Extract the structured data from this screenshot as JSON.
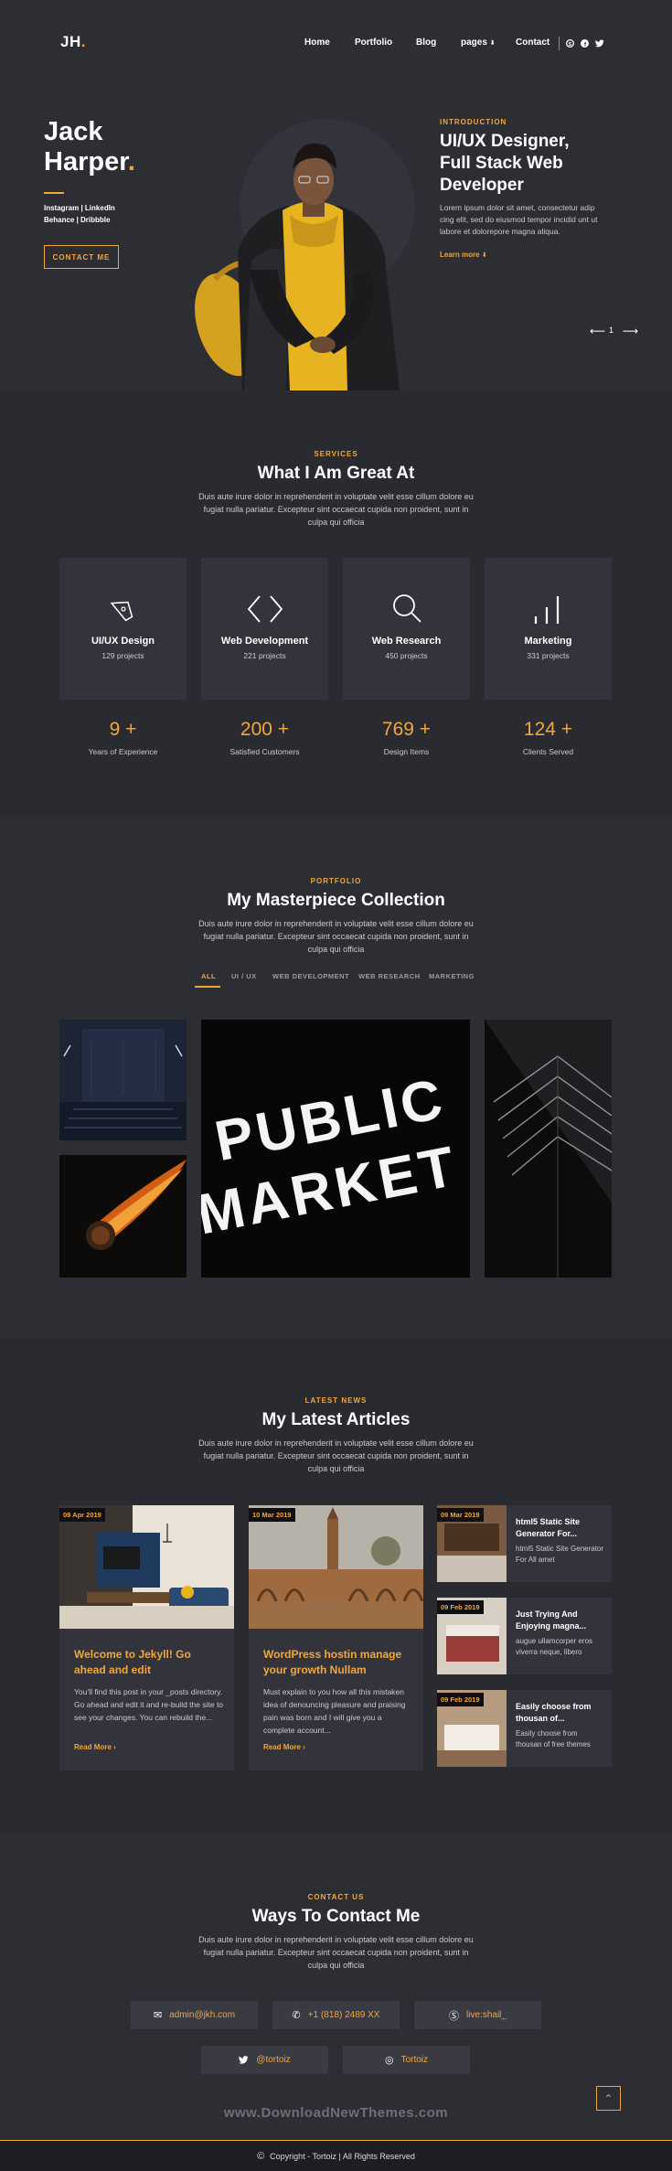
{
  "nav": {
    "logo_text": "JH",
    "logo_dot": ".",
    "items": [
      "Home",
      "Portfolio",
      "Blog",
      "pages",
      "Contact"
    ],
    "pages_caret": "⬇",
    "social_icons": [
      "skype-icon",
      "facebook-icon",
      "twitter-icon"
    ]
  },
  "hero": {
    "first_name": "Jack",
    "last_name": "Harper",
    "name_dot": ".",
    "links_line1": "Instagram | LinkedIn",
    "links_line2": "Behance | Dribbble",
    "button": "CONTACT ME",
    "intro_label": "INTRODUCTION",
    "intro_title": "UI/UX Designer, Full Stack Web Developer",
    "intro_text": "Lorem ipsum dolor sit amet, consectetur adip cing elit, sed do eiusmod tempor incidid unt ut labore et dolorepore magna aliqua.",
    "learn_more": "Learn more",
    "learn_caret": "⬇",
    "slide_number": "1"
  },
  "services": {
    "label": "SERVICES",
    "title": "What I Am Great At",
    "desc": "Duis aute irure dolor in reprehenderit in voluptate velit esse cillum dolore eu fugiat nulla pariatur. Excepteur sint occaecat cupida non proident, sunt in culpa qui officia",
    "cards": [
      {
        "title": "UI/UX Design",
        "sub": "129 projects",
        "icon": "pen-tool-icon"
      },
      {
        "title": "Web Development",
        "sub": "221 projects",
        "icon": "code-brackets-icon"
      },
      {
        "title": "Web Research",
        "sub": "450 projects",
        "icon": "magnifier-icon"
      },
      {
        "title": "Marketing",
        "sub": "331 projects",
        "icon": "bar-chart-icon"
      }
    ],
    "stats": [
      {
        "num": "9 +",
        "label": "Years of Experience"
      },
      {
        "num": "200 +",
        "label": "Satisfied Customers"
      },
      {
        "num": "769 +",
        "label": "Design Items"
      },
      {
        "num": "124 +",
        "label": "Clients Served"
      }
    ]
  },
  "portfolio": {
    "label": "PORTFOLIO",
    "title": "My Masterpiece Collection",
    "desc": "Duis aute irure dolor in reprehenderit in voluptate velit esse cillum dolore eu fugiat nulla pariatur. Excepteur sint occaecat cupida non proident, sunt in culpa qui officia",
    "filters": [
      "ALL",
      "UI / UX",
      "WEB DEVELOPMENT",
      "WEB RESEARCH",
      "MARKETING"
    ],
    "sign_line1": "PUBLIC",
    "sign_line2": "MARKET"
  },
  "news": {
    "label": "LATEST NEWS",
    "title": "My Latest Articles",
    "desc": "Duis aute irure dolor in reprehenderit in voluptate velit esse cillum dolore eu fugiat nulla pariatur. Excepteur sint occaecat cupida non proident, sunt in culpa qui officia",
    "posts": [
      {
        "date": "08 Apr 2019",
        "title": "Welcome to Jekyll! Go ahead and edit",
        "text": "You’ll find this post in your _posts directory. Go ahead and edit it and re-build the site to see your changes. You can rebuild the...",
        "read": "Read More"
      },
      {
        "date": "10 Mar 2019",
        "title": "WordPress hostin manage your growth Nullam",
        "text": "Must explain to you how all this mistaken idea of denouncing pleasure and praising pain was born and I will give you a complete account...",
        "read": "Read More"
      }
    ],
    "side_posts": [
      {
        "date": "09 Mar 2019",
        "title": "html5 Static Site Generator For...",
        "text": "html5 Static Site Generator For All amet"
      },
      {
        "date": "09 Feb 2019",
        "title": "Just Trying And Enjoying magna...",
        "text": "augue ullamcorper eros viverra neque, libero"
      },
      {
        "date": "09 Feb 2019",
        "title": "Easily choose from thousan of...",
        "text": "Easily choose from thousan of free themes"
      }
    ]
  },
  "contact": {
    "label": "CONTACT US",
    "title": "Ways To Contact Me",
    "desc": "Duis aute irure dolor in reprehenderit in voluptate velit esse cillum dolore eu fugiat nulla pariatur. Excepteur sint occaecat cupida non proident, sunt in culpa qui officia",
    "email": "admin@jkh.com",
    "phone": "+1 (818) 2489 XX",
    "skype": "live:shail_",
    "twitter": "@tortoiz",
    "dribbble": "Tortoiz"
  },
  "watermark": "www.DownloadNewThemes.com",
  "footer": {
    "text": "Copyright - Tortoiz | All Rights Reserved"
  },
  "colors": {
    "accent": "#f2a63b",
    "background": "#2a2b31",
    "card": "#33343b"
  }
}
